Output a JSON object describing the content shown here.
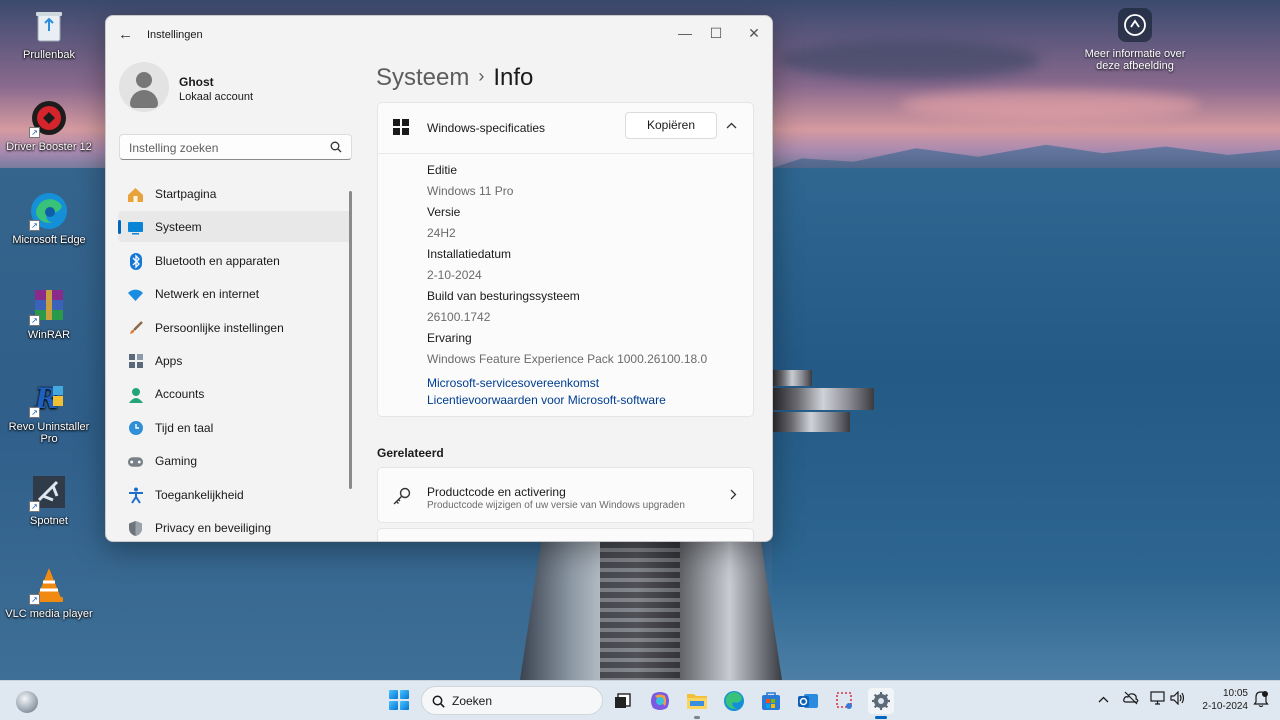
{
  "desktop": {
    "icons": [
      {
        "label": "Prullenbak",
        "icon": "recycle-bin-icon"
      },
      {
        "label": "Driver Booster 12",
        "icon": "driver-booster-icon"
      },
      {
        "label": "Microsoft Edge",
        "icon": "edge-icon"
      },
      {
        "label": "WinRAR",
        "icon": "winrar-icon"
      },
      {
        "label": "Revo Uninstaller Pro",
        "icon": "revo-uninstaller-icon"
      },
      {
        "label": "Spotnet",
        "icon": "spotnet-icon"
      },
      {
        "label": "VLC media player",
        "icon": "vlc-icon"
      }
    ],
    "wallpaper_info": {
      "line1": "Meer informatie over",
      "line2": "deze afbeelding"
    }
  },
  "window": {
    "title": "Instellingen",
    "controls": {
      "minimize": "—",
      "maximize": "☐",
      "close": "✕"
    },
    "profile": {
      "name": "Ghost",
      "account_type": "Lokaal account"
    },
    "search": {
      "placeholder": "Instelling zoeken"
    },
    "nav": [
      {
        "label": "Startpagina",
        "icon": "home-icon",
        "color": "#e8a33c"
      },
      {
        "label": "Systeem",
        "icon": "system-icon",
        "color": "#0a84d6",
        "active": true
      },
      {
        "label": "Bluetooth en apparaten",
        "icon": "bluetooth-icon",
        "color": "#1578d6"
      },
      {
        "label": "Netwerk en internet",
        "icon": "wifi-icon",
        "color": "#1a8de0"
      },
      {
        "label": "Persoonlijke instellingen",
        "icon": "brush-icon",
        "color": "#d87a3b"
      },
      {
        "label": "Apps",
        "icon": "apps-icon",
        "color": "#5a6a7a"
      },
      {
        "label": "Accounts",
        "icon": "accounts-icon",
        "color": "#22a57a"
      },
      {
        "label": "Tijd en taal",
        "icon": "time-language-icon",
        "color": "#2f8fd8"
      },
      {
        "label": "Gaming",
        "icon": "gaming-icon",
        "color": "#7a8088"
      },
      {
        "label": "Toegankelijkheid",
        "icon": "accessibility-icon",
        "color": "#1f6fc9"
      },
      {
        "label": "Privacy en beveiliging",
        "icon": "shield-icon",
        "color": "#6d747c"
      }
    ],
    "breadcrumb": {
      "parent": "Systeem",
      "separator": "›",
      "current": "Info"
    },
    "specs": {
      "title": "Windows-specificaties",
      "copy_label": "Kopiëren",
      "rows": [
        {
          "label": "Editie",
          "value": "Windows 11 Pro"
        },
        {
          "label": "Versie",
          "value": "24H2"
        },
        {
          "label": "Installatiedatum",
          "value": "2-10-2024"
        },
        {
          "label": "Build van besturingssysteem",
          "value": "26100.1742"
        },
        {
          "label": "Ervaring",
          "value": "Windows Feature Experience Pack 1000.26100.18.0"
        }
      ],
      "links": [
        "Microsoft-servicesovereenkomst",
        "Licentievoorwaarden voor Microsoft-software"
      ]
    },
    "related": {
      "heading": "Gerelateerd",
      "items": [
        {
          "title": "Productcode en activering",
          "subtitle": "Productcode wijzigen of uw versie van Windows upgraden"
        }
      ]
    }
  },
  "taskbar": {
    "search_placeholder": "Zoeken",
    "time": "10:05",
    "date": "2-10-2024"
  }
}
